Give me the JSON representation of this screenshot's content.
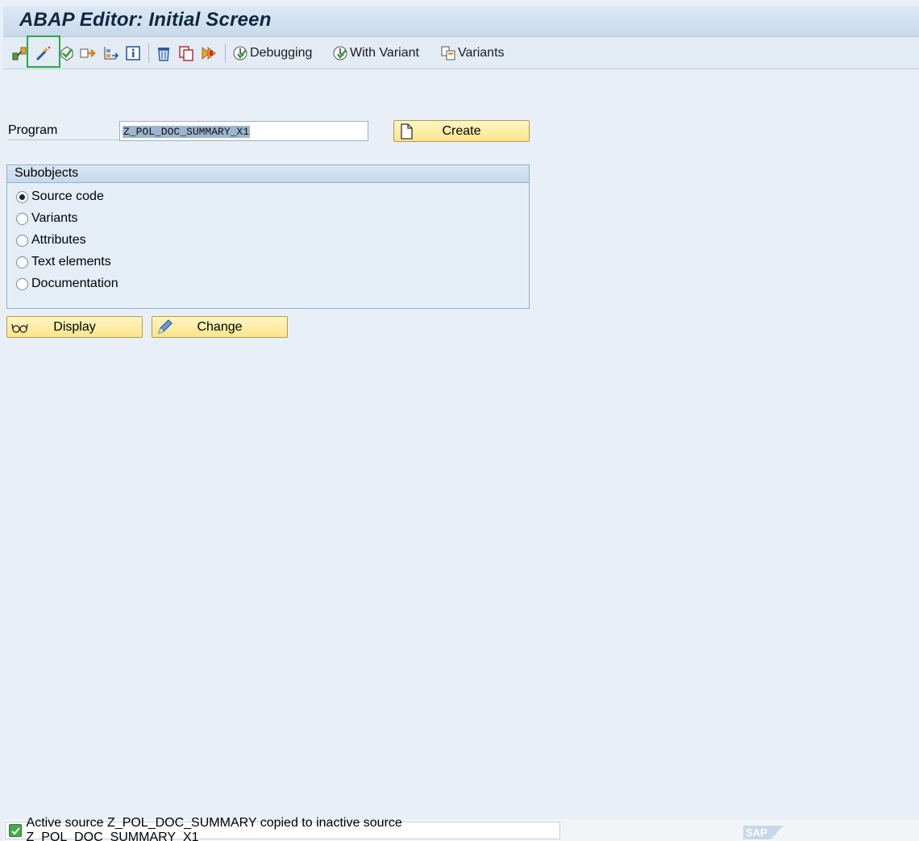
{
  "window": {
    "title": "ABAP Editor: Initial Screen"
  },
  "toolbar": {
    "icons": [
      "where-used-icon",
      "magic-wand-icon",
      "check-icon",
      "activate-icon",
      "navigate-icon",
      "info-icon",
      "delete-icon",
      "copy-icon",
      "rename-icon"
    ],
    "selected_icon": "magic-wand-icon",
    "debugging_label": "Debugging",
    "with_variant_label": "With Variant",
    "variants_label": "Variants"
  },
  "form": {
    "program_label": "Program",
    "program_value": "Z_POL_DOC_SUMMARY_X1",
    "create_label": "Create"
  },
  "subobjects": {
    "title": "Subobjects",
    "selected": "Source code",
    "options": [
      "Source code",
      "Variants",
      "Attributes",
      "Text elements",
      "Documentation"
    ]
  },
  "actions": {
    "display_label": "Display",
    "change_label": "Change"
  },
  "status": {
    "message": "Active source Z_POL_DOC_SUMMARY copied to inactive source Z_POL_DOC_SUMMARY_X1",
    "type": "success",
    "logo": "SAP"
  },
  "colors": {
    "button_yellow": "#fbe48b",
    "selection_green": "#2aa84a",
    "background": "#e8eff6"
  }
}
